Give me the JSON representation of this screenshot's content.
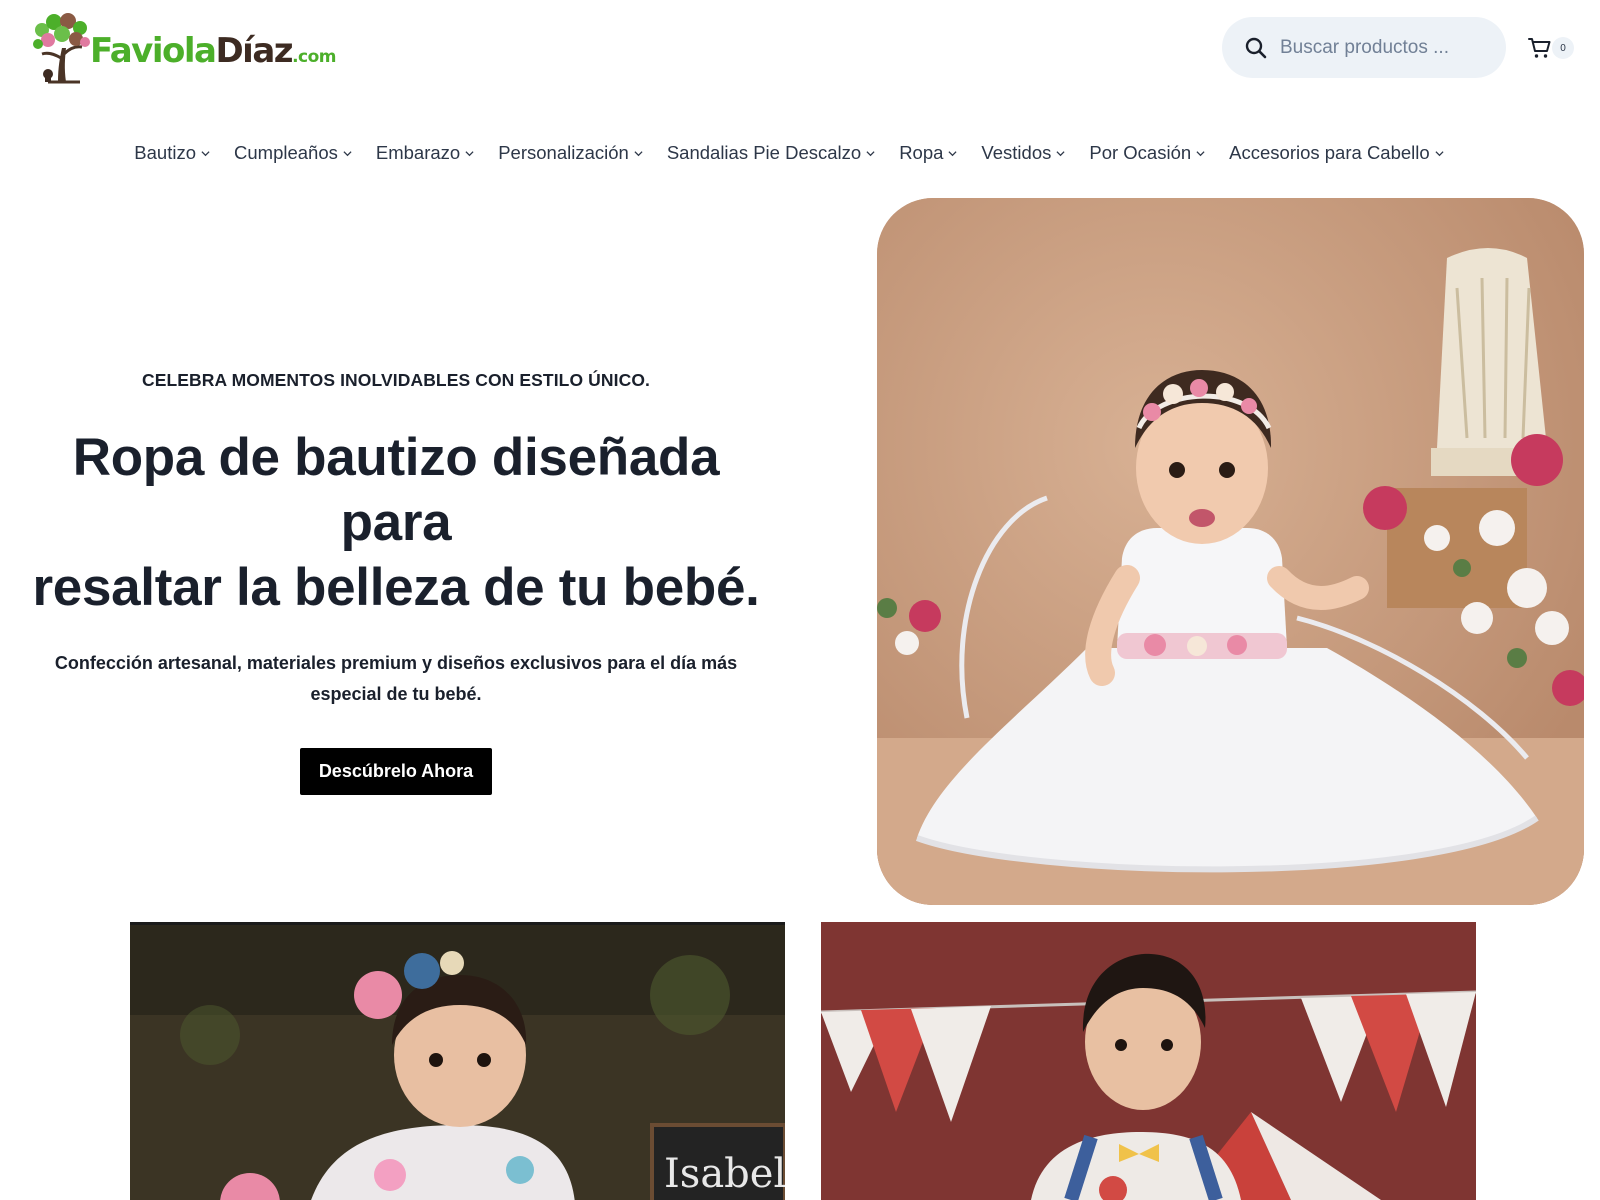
{
  "logo": {
    "part1": "Faviola",
    "part2": "Díaz",
    "part3": ".com"
  },
  "search": {
    "placeholder": "Buscar productos ..."
  },
  "cart": {
    "count": "0"
  },
  "nav": {
    "items": [
      {
        "label": "Bautizo"
      },
      {
        "label": "Cumpleaños"
      },
      {
        "label": "Embarazo"
      },
      {
        "label": "Personalización"
      },
      {
        "label": "Sandalias Pie Descalzo"
      },
      {
        "label": "Ropa"
      },
      {
        "label": "Vestidos"
      },
      {
        "label": "Por Ocasión"
      },
      {
        "label": "Accesorios para Cabello"
      }
    ]
  },
  "hero": {
    "eyebrow": "CELEBRA MOMENTOS INOLVIDABLES CON ESTILO ÚNICO.",
    "title_line1": "Ropa de bautizo diseñada para",
    "title_line2": "resaltar la belleza de tu bebé.",
    "subtitle": "Confección artesanal, materiales premium y diseños exclusivos para el día más especial de tu bebé.",
    "button": "Descúbrelo Ahora"
  },
  "cards": {
    "left_sign_text": "Isabel"
  },
  "colors": {
    "brand_green": "#4caf2a",
    "brand_brown": "#3d2b22",
    "button_bg": "#000000"
  }
}
